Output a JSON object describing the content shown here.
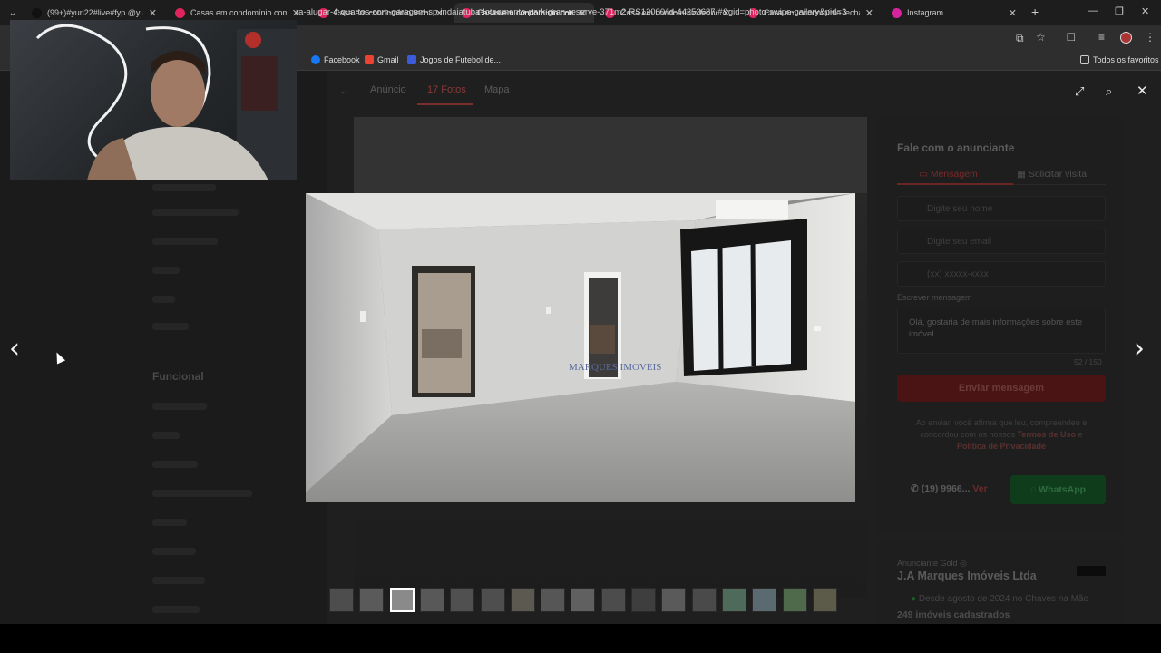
{
  "browser": {
    "tabs": [
      {
        "label": "(99+)#yuri22#live#fyp @yurib",
        "favicon_color": "#111111",
        "active": false
      },
      {
        "label": "Casas em condomínio com pis",
        "favicon_color": "#e0245e",
        "active": false
      },
      {
        "label": "Casa em condomínio fechado",
        "favicon_color": "#e0245e",
        "active": false
      },
      {
        "label": "Casas em condomínio com 4 q",
        "favicon_color": "#e0245e",
        "active": true
      },
      {
        "label": "Casa em condomínio fechado",
        "favicon_color": "#e0245e",
        "active": false
      },
      {
        "label": "Casa em condomínio fechado",
        "favicon_color": "#e0245e",
        "active": false
      },
      {
        "label": "Instagram",
        "favicon_color": "#d6249f",
        "active": false
      }
    ],
    "url": "ra-alugar-4-quartos-com-garagem-sp-indaiatuba-loteamento-park-gran-reserve-371m2-RS12000/id-44253687/#&gid=photo-swipe-gallery&pid=3",
    "bookmarks": [
      {
        "label": "Facebook",
        "icon_color": "#1877f2"
      },
      {
        "label": "Gmail",
        "icon_color": "#ea4335"
      },
      {
        "label": "Jogos de Futebol de...",
        "icon_color": "#3b5bdb"
      }
    ],
    "all_bookmarks_label": "Todos os favoritos"
  },
  "listing_modal": {
    "tabs": [
      "Anúncio",
      "17 Fotos",
      "Mapa"
    ],
    "active_tab": "17 Fotos",
    "left_sidebar_heading": "Funcional"
  },
  "contact_form": {
    "title": "Fale com o anunciante",
    "tab_message": "Mensagem",
    "tab_visit": "Solicitar visita",
    "name_placeholder": "Digite seu nome",
    "email_placeholder": "Digite seu email",
    "phone_placeholder": "(xx) xxxxx-xxxx",
    "message_label": "Escrever mensagem",
    "message_value": "Olá, gostaria de mais informações sobre este imóvel.",
    "char_count": "52 / 150",
    "send_label": "Enviar mensagem",
    "disclaimer_prefix": "Ao enviar, você afirma que leu, compreendeu e concordou com os nossos",
    "terms_label": "Termos de Uso",
    "disclaimer_and": "e",
    "privacy_label": "Política de Privacidade",
    "phone_number": "(19) 9966...",
    "phone_reveal": "Ver",
    "whatsapp_label": "WhatsApp"
  },
  "advertiser": {
    "badge": "Anunciante Gold",
    "name": "J.A Marques Imóveis Ltda",
    "since": "Desde agosto de 2024 no Chaves na Mão",
    "listings": "249 imóveis cadastrados"
  },
  "gallery": {
    "photo_watermark": "MARQUES IMOVEIS",
    "thumbnail_count": 17,
    "active_thumbnail_index": 2
  },
  "colors": {
    "brand_red": "#b3202a",
    "whatsapp_green": "#25d366"
  }
}
